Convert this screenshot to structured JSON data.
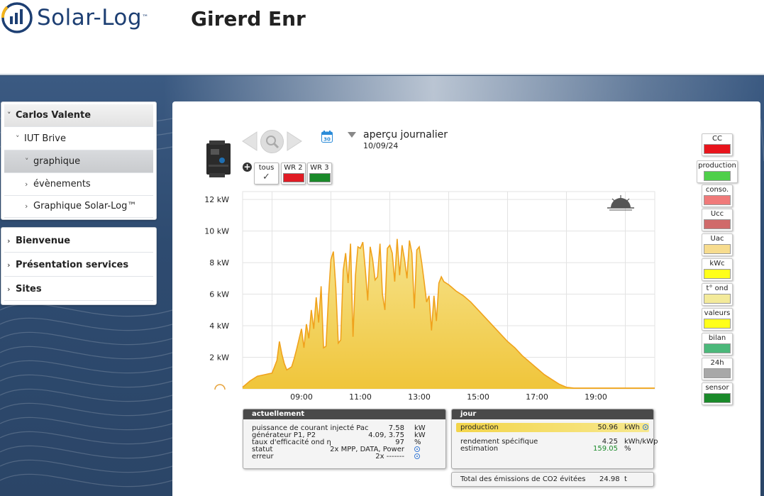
{
  "header": {
    "logo_text": "Solar-Log",
    "logo_tm": "™",
    "site_title": "Girerd Enr"
  },
  "sidebar": {
    "tree": [
      {
        "label": "Carlos Valente"
      },
      {
        "label": "IUT Brive"
      },
      {
        "label": "graphique"
      },
      {
        "label": "évènements"
      },
      {
        "label": "Graphique Solar-Log™"
      }
    ],
    "menu": [
      {
        "label": "Bienvenue"
      },
      {
        "label": "Présentation services"
      },
      {
        "label": "Sites"
      }
    ]
  },
  "toolbar": {
    "view_title": "aperçu journalier",
    "view_date": "10/09/24",
    "calendar_day": "30"
  },
  "inverters": [
    {
      "label": "tous",
      "color": null
    },
    {
      "label": "WR 2",
      "color": "#e01b24"
    },
    {
      "label": "WR 3",
      "color": "#1a8a2a"
    }
  ],
  "legend_buttons": [
    {
      "label": "CC",
      "color": "#e8141c"
    },
    {
      "label": "production",
      "color": "#4fcf4a"
    },
    {
      "label": "conso.",
      "color": "#f07a7a"
    },
    {
      "label": "Ucc",
      "color": "#d06a6a"
    },
    {
      "label": "Uac",
      "color": "#f7dc8e"
    },
    {
      "label": "kWc",
      "color": "#ffff1a"
    },
    {
      "label": "t° ond",
      "color": "#f3ea9a"
    },
    {
      "label": "valeurs",
      "color": "#ffff1a"
    },
    {
      "label": "bilan",
      "color": "#4bb87a"
    },
    {
      "label": "24h",
      "color": "#a8a8a8"
    },
    {
      "label": "sensor",
      "color": "#1a8a2a"
    }
  ],
  "chart_data": {
    "type": "area",
    "title": "",
    "xlabel": "",
    "ylabel": "",
    "x_ticks": [
      "09:00",
      "11:00",
      "13:00",
      "15:00",
      "17:00",
      "19:00"
    ],
    "y_ticks": [
      "2 kW",
      "4 kW",
      "6 kW",
      "8 kW",
      "10 kW",
      "12 kW"
    ],
    "xlim": [
      "07:00",
      "21:00"
    ],
    "ylim": [
      0,
      12.5
    ],
    "grid": true,
    "color": "#f0c53a",
    "series": [
      {
        "x": [
          "07:00",
          "07:15",
          "07:30",
          "07:45",
          "08:00",
          "08:10",
          "08:15",
          "08:20",
          "08:25",
          "08:30",
          "08:40",
          "08:45",
          "08:50",
          "09:00",
          "09:05",
          "09:10",
          "09:15",
          "09:20",
          "09:25",
          "09:30",
          "09:35",
          "09:40",
          "09:45",
          "09:50",
          "09:55",
          "10:00",
          "10:05",
          "10:10",
          "10:15",
          "10:20",
          "10:25",
          "10:30",
          "10:35",
          "10:40",
          "10:45",
          "10:50",
          "10:55",
          "11:00",
          "11:05",
          "11:10",
          "11:15",
          "11:20",
          "11:25",
          "11:30",
          "11:35",
          "11:40",
          "11:45",
          "11:50",
          "11:55",
          "12:00",
          "12:05",
          "12:10",
          "12:15",
          "12:20",
          "12:25",
          "12:30",
          "12:35",
          "12:40",
          "12:45",
          "12:50",
          "12:55",
          "13:00",
          "13:05",
          "13:10",
          "13:15",
          "13:20",
          "13:25",
          "13:30",
          "13:35",
          "13:40",
          "13:45",
          "13:50",
          "14:00",
          "14:15",
          "14:30",
          "14:45",
          "15:00",
          "15:15",
          "15:30",
          "15:45",
          "16:00",
          "16:15",
          "16:30",
          "16:45",
          "17:00",
          "17:15",
          "17:30",
          "17:45",
          "18:00",
          "18:15",
          "18:30",
          "18:45",
          "19:00",
          "19:15",
          "19:30",
          "20:00",
          "21:00"
        ],
        "values": [
          0.1,
          0.5,
          0.8,
          0.9,
          1.0,
          1.8,
          3.0,
          2.2,
          1.6,
          1.2,
          1.4,
          1.9,
          2.5,
          3.8,
          2.6,
          4.1,
          3.2,
          5.0,
          3.8,
          5.8,
          4.2,
          6.5,
          2.6,
          2.7,
          5.8,
          8.2,
          8.7,
          6.4,
          2.9,
          3.1,
          7.5,
          8.6,
          6.7,
          9.2,
          3.3,
          7.2,
          9.0,
          8.9,
          9.3,
          7.6,
          5.6,
          9.0,
          8.2,
          6.9,
          7.1,
          9.2,
          6.0,
          5.0,
          8.9,
          9.1,
          8.6,
          6.8,
          9.5,
          7.2,
          9.1,
          8.2,
          7.0,
          9.4,
          8.6,
          5.1,
          8.8,
          9.0,
          8.0,
          6.8,
          5.5,
          5.9,
          3.7,
          5.9,
          4.3,
          6.7,
          7.1,
          6.8,
          6.6,
          6.2,
          5.9,
          5.5,
          5.0,
          4.5,
          4.0,
          3.5,
          3.0,
          2.6,
          2.1,
          1.7,
          1.3,
          0.9,
          0.6,
          0.3,
          0.1,
          0.05,
          0.05,
          0.05,
          0.05,
          0.05,
          0.05,
          0.05,
          0.05
        ]
      }
    ]
  },
  "current": {
    "title": "actuellement",
    "rows": [
      {
        "label": "puissance de courant injecté Pac",
        "value": "7.58",
        "unit": "kW"
      },
      {
        "label": "générateur P1, P2",
        "value": "4.09, 3.75",
        "unit": "kW"
      },
      {
        "label": "taux d'efficacité ond η",
        "value": "97",
        "unit": "%"
      },
      {
        "label": "statut",
        "value": "2x MPP, DATA, Power",
        "unit": ""
      },
      {
        "label": "erreur",
        "value": "2x -------",
        "unit": ""
      }
    ]
  },
  "day": {
    "title": "jour",
    "production_label": "production",
    "production_value": "50.96",
    "production_unit": "kWh",
    "yield_label": "rendement spécifique",
    "yield_value": "4.25",
    "yield_unit": "kWh/kWp",
    "estimate_label": "estimation",
    "estimate_value": "159.05",
    "estimate_value_color": "#1a8a2a",
    "estimate_unit": "%"
  },
  "co2": {
    "label": "Total des émissions de CO2 évitées",
    "value": "24.98",
    "unit": "t"
  }
}
